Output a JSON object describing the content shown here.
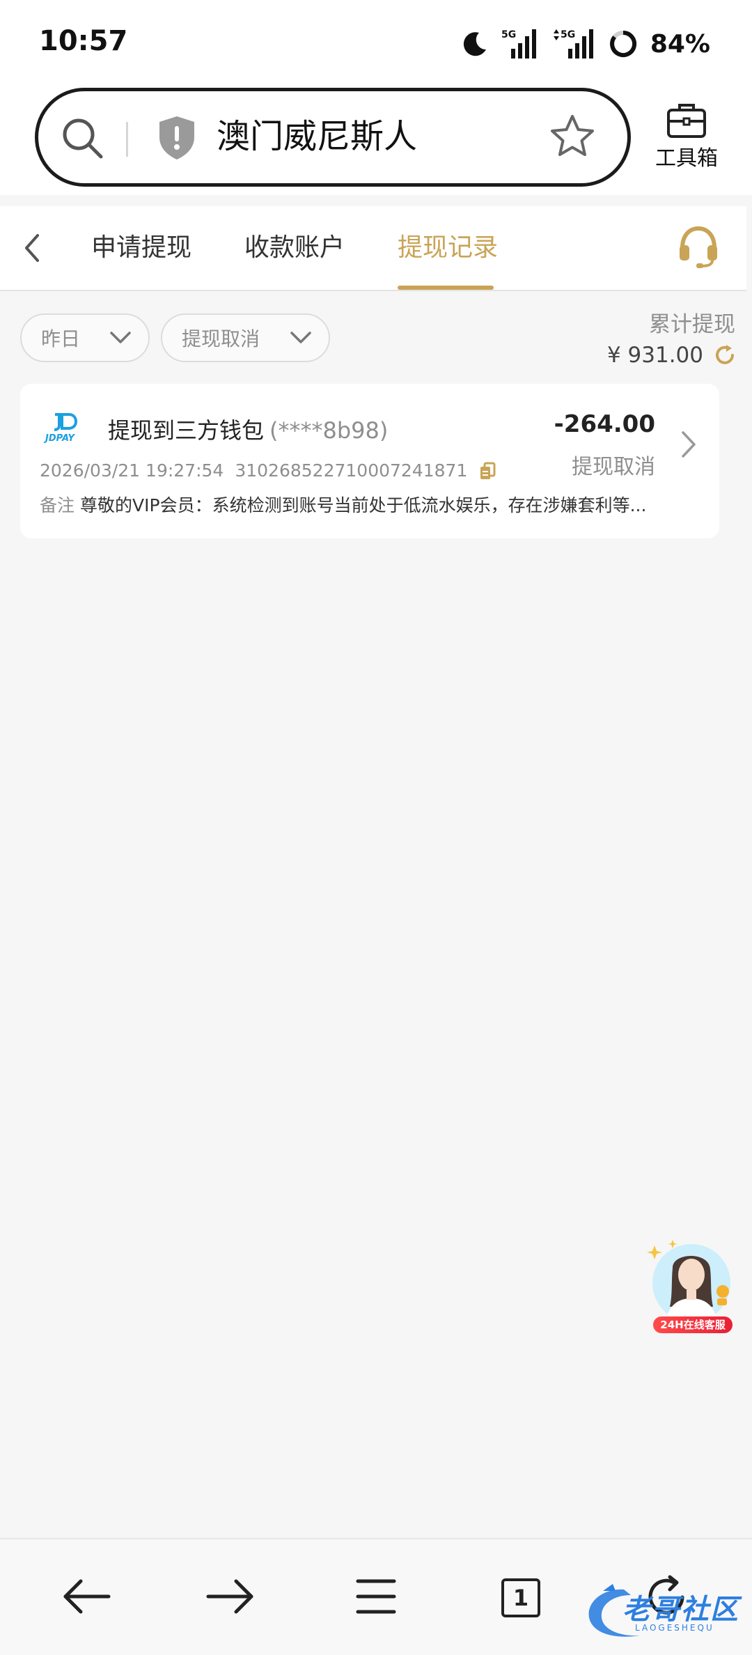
{
  "status_bar": {
    "time": "10:57",
    "network_1": "5G",
    "network_2": "5G",
    "battery": "84%"
  },
  "browser": {
    "address": "澳门威尼斯人",
    "toolbox_label": "工具箱"
  },
  "tabs": [
    {
      "label": "申请提现",
      "active": false
    },
    {
      "label": "收款账户",
      "active": false
    },
    {
      "label": "提现记录",
      "active": true
    }
  ],
  "filters": {
    "date": "昨日",
    "status": "提现取消"
  },
  "summary": {
    "label": "累计提现",
    "amount": "¥ 931.00"
  },
  "record": {
    "logo_text": "JDPAY",
    "title": "提现到三方钱包",
    "account": "(****8b98)",
    "amount": "-264.00",
    "status": "提现取消",
    "datetime": "2026/03/21 19:27:54",
    "order_no": "310268522710007241871",
    "note_label": "备注",
    "note": "尊敬的VIP会员：系统检测到账号当前处于低流水娱乐，存在涉嫌套利等..."
  },
  "float_service": {
    "label": "24H在线客服"
  },
  "bottom_nav": {
    "tab_count": "1"
  },
  "watermark": {
    "text": "老哥社区",
    "sub": "LAOGESHEQU"
  },
  "colors": {
    "accent": "#c9a456",
    "muted": "#8e8e8e",
    "background": "#f6f6f6"
  }
}
